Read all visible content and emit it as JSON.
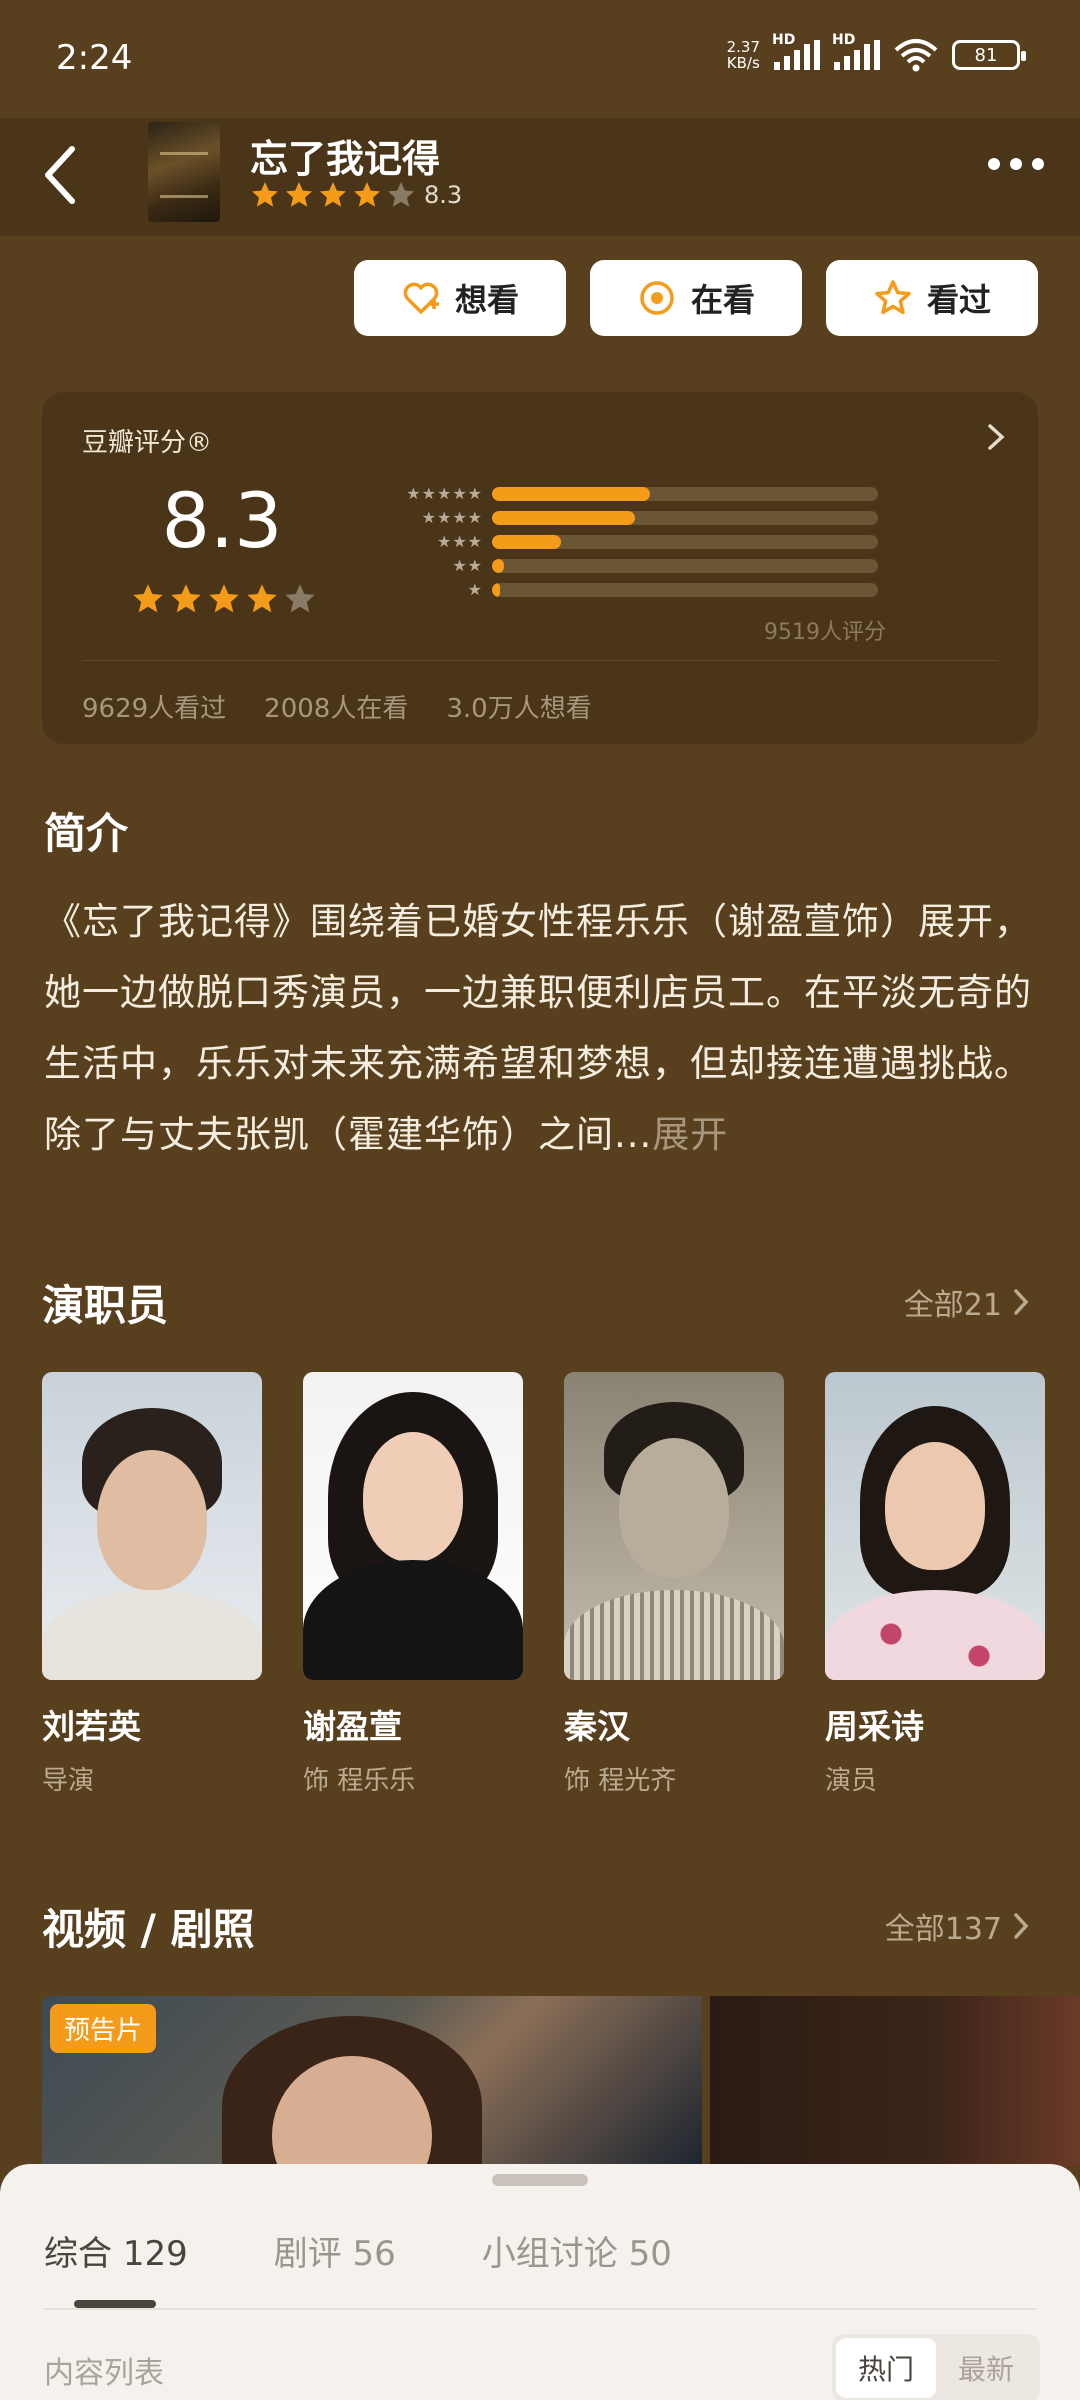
{
  "status_bar": {
    "time": "2:24",
    "net_speed_value": "2.37",
    "net_speed_unit": "KB/s",
    "hd1": "HD",
    "hd2": "HD",
    "battery": "81"
  },
  "header": {
    "title": "忘了我记得",
    "rating": "8.3",
    "stars_filled": 4
  },
  "actions": [
    {
      "label": "想看",
      "icon": "heart-plus-icon"
    },
    {
      "label": "在看",
      "icon": "record-icon"
    },
    {
      "label": "看过",
      "icon": "star-outline-icon"
    }
  ],
  "rating_card": {
    "label": "豆瓣评分®",
    "score": "8.3",
    "stars_filled": 4,
    "distribution": [
      {
        "stars": 5,
        "fraction": 0.41
      },
      {
        "stars": 4,
        "fraction": 0.37
      },
      {
        "stars": 3,
        "fraction": 0.18
      },
      {
        "stars": 2,
        "fraction": 0.03
      },
      {
        "stars": 1,
        "fraction": 0.01
      }
    ],
    "count": "9519人评分",
    "watched": "9629人看过",
    "watching": "2008人在看",
    "want": "3.0万人想看"
  },
  "intro": {
    "title": "简介",
    "text": "《忘了我记得》围绕着已婚女性程乐乐（谢盈萱饰）展开，她一边做脱口秀演员，一边兼职便利店员工。在平淡无奇的生活中，乐乐对未来充满希望和梦想，但却接连遭遇挑战。除了与丈夫张凯（霍建华饰）之间...",
    "expand": "展开"
  },
  "cast": {
    "title": "演职员",
    "see_all": "全部21",
    "members": [
      {
        "name": "刘若英",
        "role": "导演"
      },
      {
        "name": "谢盈萱",
        "role": "饰 程乐乐"
      },
      {
        "name": "秦汉",
        "role": "饰 程光齐"
      },
      {
        "name": "周采诗",
        "role": "演员"
      }
    ]
  },
  "videos": {
    "title": "视频 / 剧照",
    "see_all": "全部137",
    "tag": "预告片"
  },
  "sheet": {
    "tabs": [
      {
        "label": "综合",
        "count": "129"
      },
      {
        "label": "剧评",
        "count": "56"
      },
      {
        "label": "小组讨论",
        "count": "50"
      }
    ],
    "subtitle": "内容列表",
    "sort_hot": "热门",
    "sort_new": "最新"
  },
  "colors": {
    "background": "#58401f",
    "accent": "#f49b1a",
    "card": "#4a3518"
  }
}
